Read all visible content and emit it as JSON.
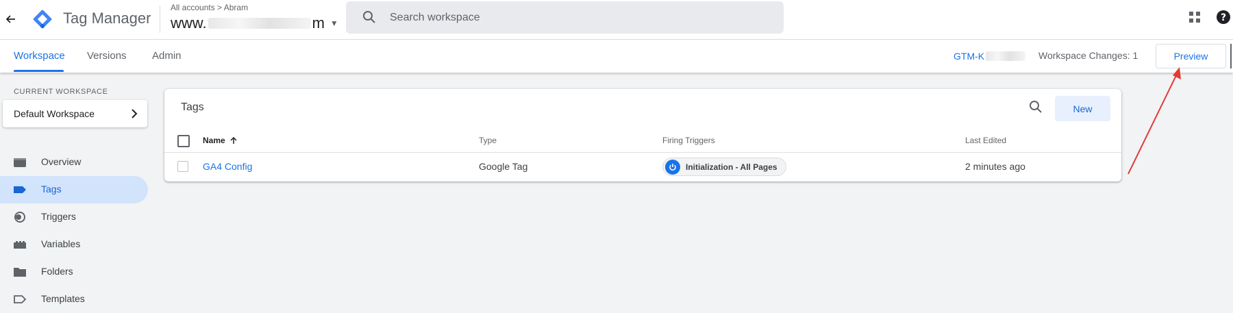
{
  "header": {
    "app_title": "Tag Manager",
    "breadcrumb_all": "All accounts",
    "breadcrumb_sep": ">",
    "breadcrumb_account": "Abram",
    "container_prefix": "www.",
    "container_suffix": "m",
    "search_placeholder": "Search workspace"
  },
  "tabs": [
    {
      "label": "Workspace",
      "active": true
    },
    {
      "label": "Versions",
      "active": false
    },
    {
      "label": "Admin",
      "active": false
    }
  ],
  "toolbar": {
    "gtm_id_prefix": "GTM-K",
    "workspace_changes": "Workspace Changes: 1",
    "preview_label": "Preview"
  },
  "sidebar": {
    "current_workspace_label": "CURRENT WORKSPACE",
    "workspace_name": "Default Workspace",
    "items": [
      {
        "label": "Overview",
        "icon": "overview-icon",
        "active": false
      },
      {
        "label": "Tags",
        "icon": "tag-icon",
        "active": true
      },
      {
        "label": "Triggers",
        "icon": "trigger-icon",
        "active": false
      },
      {
        "label": "Variables",
        "icon": "variables-icon",
        "active": false
      },
      {
        "label": "Folders",
        "icon": "folder-icon",
        "active": false
      },
      {
        "label": "Templates",
        "icon": "template-icon",
        "active": false
      }
    ]
  },
  "tags_card": {
    "title": "Tags",
    "new_label": "New",
    "columns": [
      "Name",
      "Type",
      "Firing Triggers",
      "Last Edited"
    ],
    "rows": [
      {
        "name": "GA4 Config",
        "type": "Google Tag",
        "trigger": "Initialization - All Pages",
        "last_edited": "2 minutes ago"
      }
    ]
  },
  "colors": {
    "accent": "#1a73e8",
    "active_nav_bg": "#d2e3fc",
    "annotation_arrow": "#e53935"
  }
}
